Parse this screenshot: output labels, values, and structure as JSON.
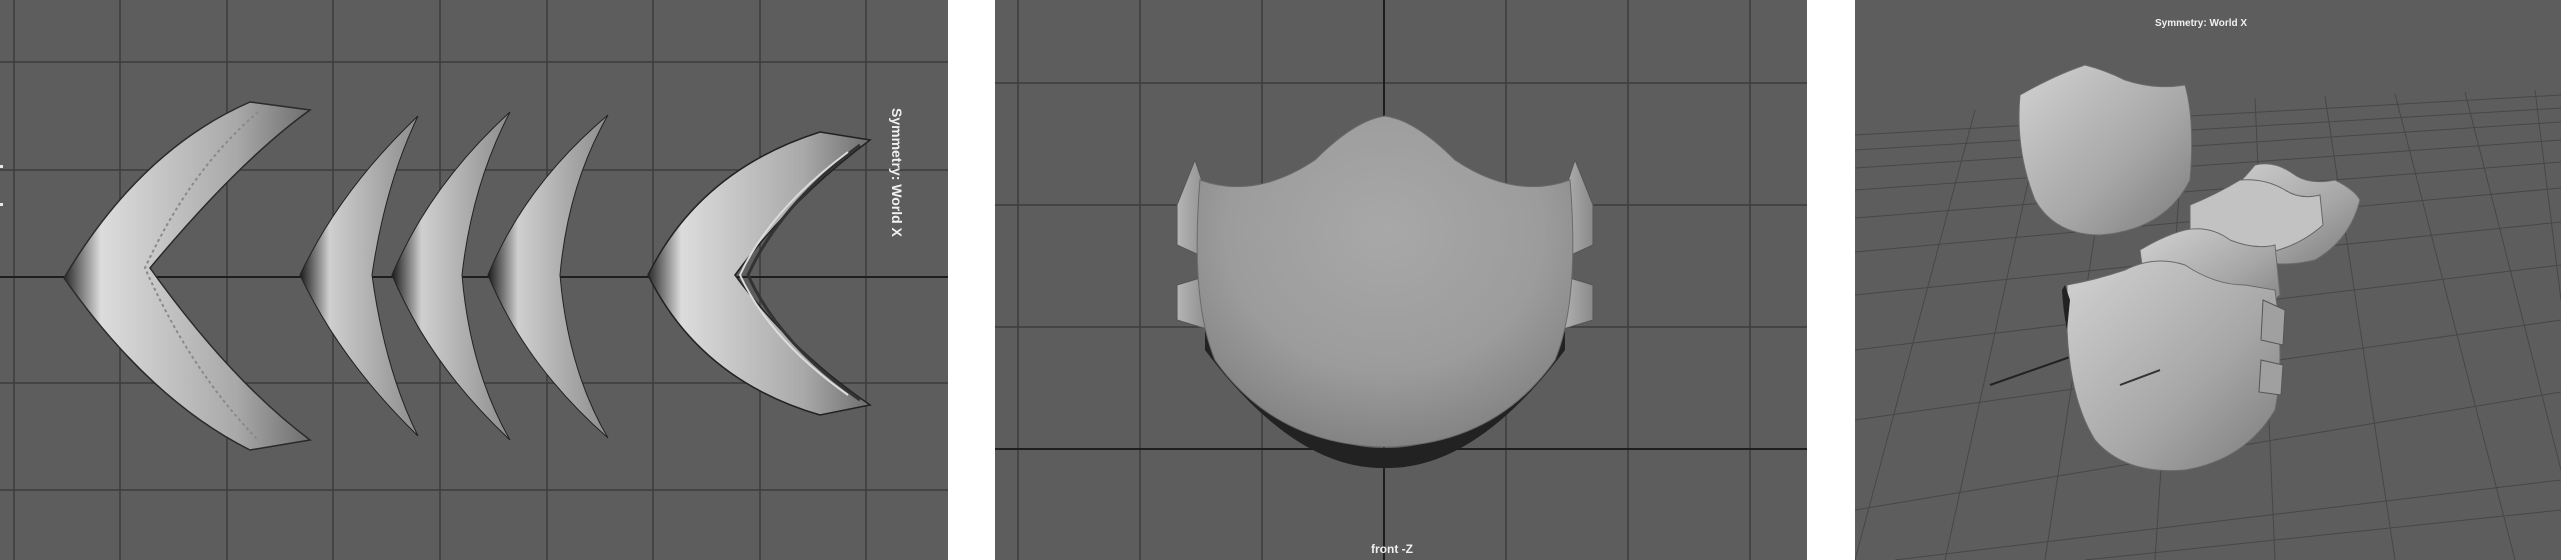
{
  "viewports": {
    "left": {
      "hud": "Symmetry: World X"
    },
    "center": {
      "hud": "front -Z"
    },
    "right": {
      "hud": "Symmetry: World X"
    }
  },
  "colors": {
    "viewport_bg": "#5d5d5d",
    "grid_line": "#3c3c3c",
    "axis_line": "#1e1e1e",
    "mesh_light": "#c8c8c8",
    "mesh_shade": "#7a7a7a"
  }
}
